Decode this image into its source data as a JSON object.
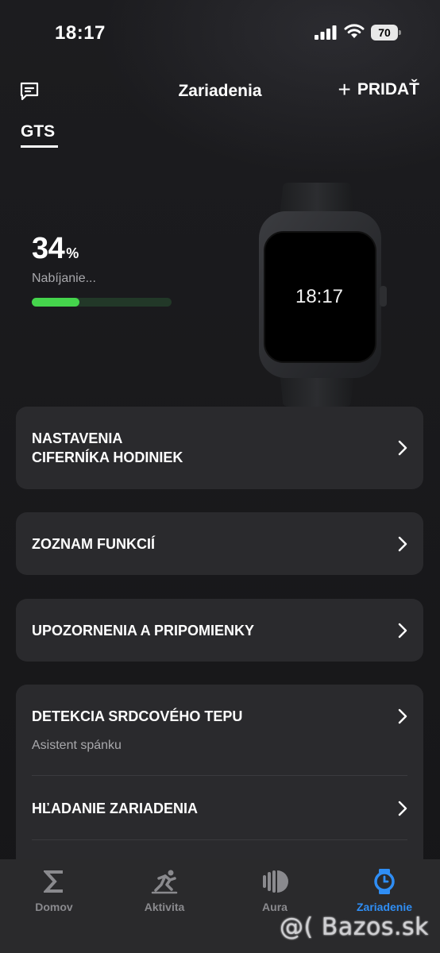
{
  "status_bar": {
    "time": "18:17",
    "battery_level": "70"
  },
  "header": {
    "title": "Zariadenia",
    "add_label": "PRIDAŤ",
    "feedback_icon": "message-square-icon"
  },
  "device_tab": {
    "label": "GTS"
  },
  "battery": {
    "percent": "34",
    "unit": "%",
    "status": "Nabíjanie...",
    "fill_fraction": 0.34
  },
  "watch": {
    "display_time": "18:17"
  },
  "cards": {
    "watchface": {
      "line1": "NASTAVENIA",
      "line2": "CIFERNÍKA HODINIEK"
    },
    "features": {
      "label": "ZOZNAM FUNKCIÍ"
    },
    "notifications": {
      "label": "UPOZORNENIA A PRIPOMIENKY"
    },
    "heart": {
      "label": "DETEKCIA SRDCOVÉHO TEPU",
      "sub": "Asistent spánku"
    },
    "find": {
      "label": "HĽADANIE ZARIADENIA"
    }
  },
  "tabs": [
    {
      "label": "Domov",
      "icon": "sigma-icon"
    },
    {
      "label": "Aktivita",
      "icon": "running-icon"
    },
    {
      "label": "Aura",
      "icon": "aura-icon"
    },
    {
      "label": "Zariadenie",
      "icon": "watch-icon",
      "active": true
    }
  ],
  "colors": {
    "accent": "#2f8ef5",
    "battery_fill": "#45d44c"
  },
  "watermark": "@( Bazos.sk"
}
